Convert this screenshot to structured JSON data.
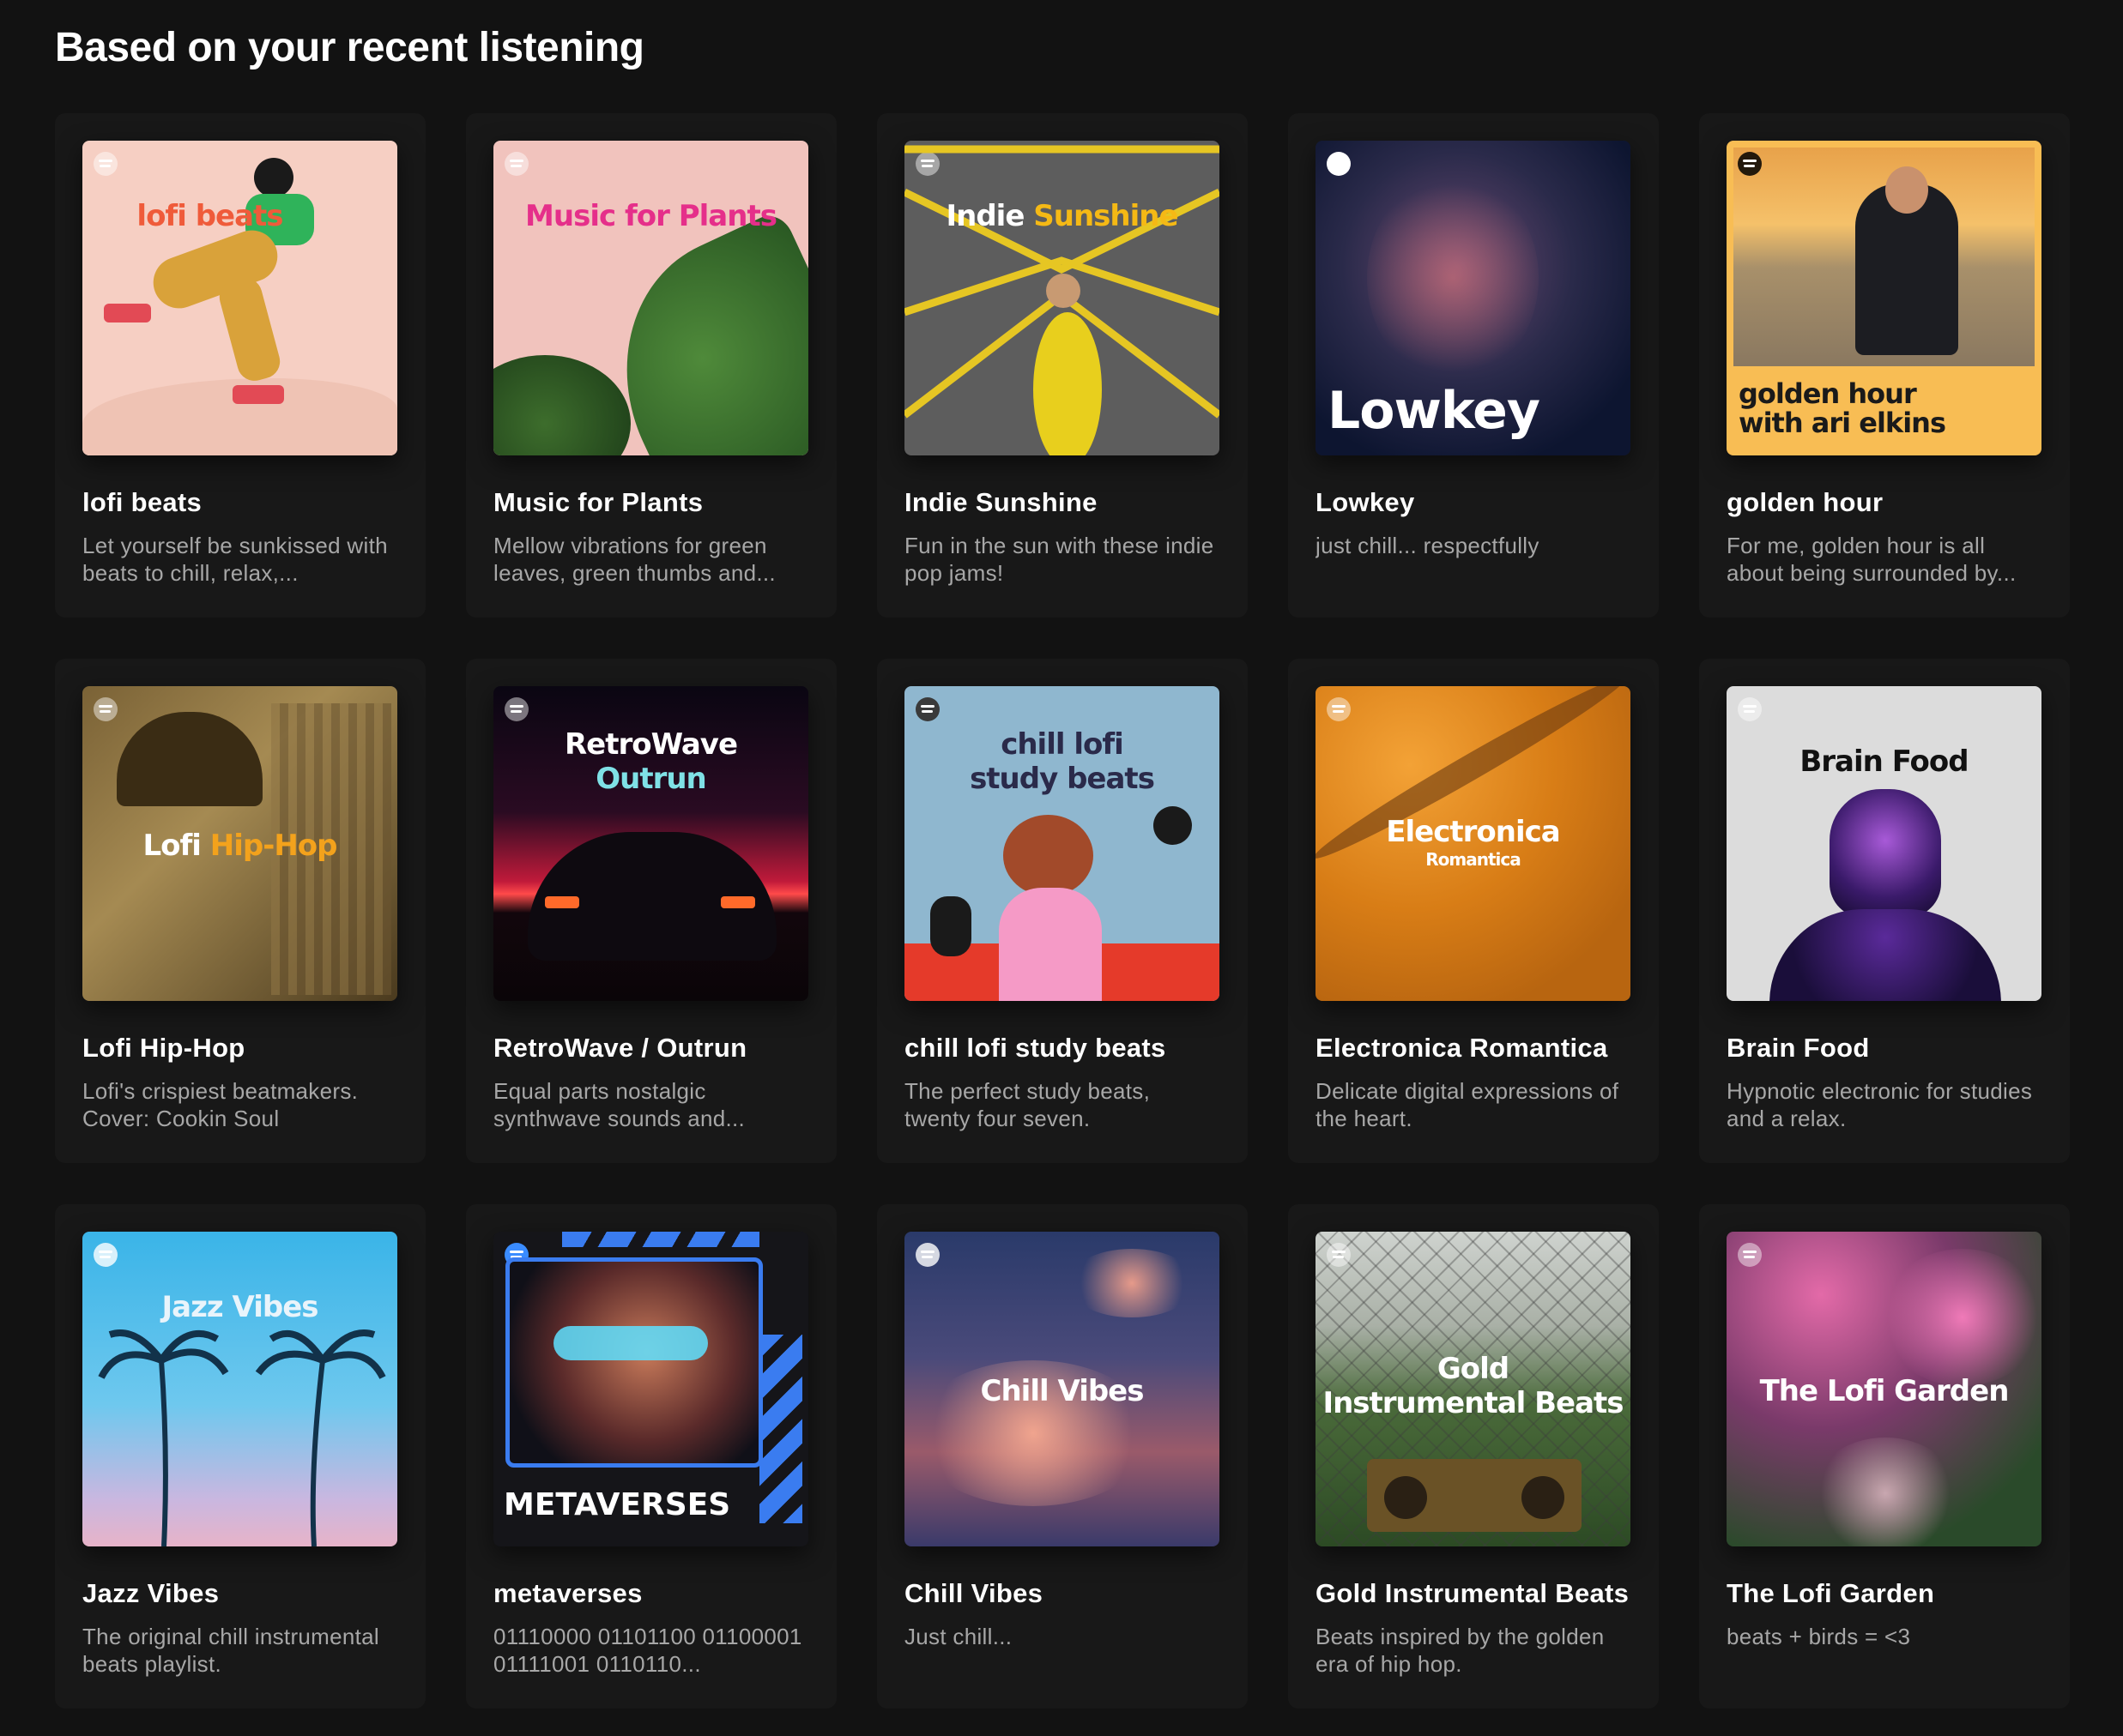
{
  "section": {
    "title": "Based on your recent listening"
  },
  "cards": [
    {
      "title": "lofi beats",
      "description": "Let yourself be sunkissed with beats to chill, relax,...",
      "cover_text": "lofi beats"
    },
    {
      "title": "Music for Plants",
      "description": "Mellow vibrations for green leaves, green thumbs and...",
      "cover_text": "Music for Plants"
    },
    {
      "title": "Indie Sunshine",
      "description": "Fun in the sun with these indie pop jams!",
      "cover_text_a": "Indie",
      "cover_text_b": "Sunshine"
    },
    {
      "title": "Lowkey",
      "description": "just chill... respectfully",
      "cover_text": "Lowkey"
    },
    {
      "title": "golden hour",
      "description": "For me, golden hour is all about being surrounded by...",
      "cover_text_a": "golden hour",
      "cover_text_b": "with ari elkins"
    },
    {
      "title": "Lofi Hip-Hop",
      "description": "Lofi's crispiest beatmakers. Cover: Cookin Soul",
      "cover_text_a": "Lofi",
      "cover_text_b": "Hip-Hop"
    },
    {
      "title": "RetroWave / Outrun",
      "description": "Equal parts nostalgic synthwave sounds and...",
      "cover_text_a": "RetroWave",
      "cover_text_b": "Outrun"
    },
    {
      "title": "chill lofi study beats",
      "description": "The perfect study beats, twenty four seven.",
      "cover_text_a": "chill lofi",
      "cover_text_b": "study beats"
    },
    {
      "title": "Electronica Romantica",
      "description": "Delicate digital expressions of the heart.",
      "cover_text_a": "Electronica",
      "cover_text_b": "Romantica"
    },
    {
      "title": "Brain Food",
      "description": "Hypnotic electronic for studies and a relax.",
      "cover_text": "Brain Food"
    },
    {
      "title": "Jazz Vibes",
      "description": "The original chill instrumental beats playlist.",
      "cover_text": "Jazz Vibes"
    },
    {
      "title": "metaverses",
      "description": "01110000 01101100 01100001 01111001 0110110...",
      "cover_text": "METAVERSES"
    },
    {
      "title": "Chill Vibes",
      "description": "Just chill...",
      "cover_text": "Chill Vibes"
    },
    {
      "title": "Gold Instrumental Beats",
      "description": "Beats inspired by the golden era of hip hop.",
      "cover_text_a": "Gold",
      "cover_text_b": "Instrumental Beats"
    },
    {
      "title": "The Lofi Garden",
      "description": "beats + birds = <3",
      "cover_text": "The Lofi Garden"
    }
  ],
  "colors": {
    "background": "#121212",
    "card": "#181818",
    "subtext": "#a7a7a7"
  },
  "icons": {
    "cover_badge": "spotify-logo-icon"
  }
}
